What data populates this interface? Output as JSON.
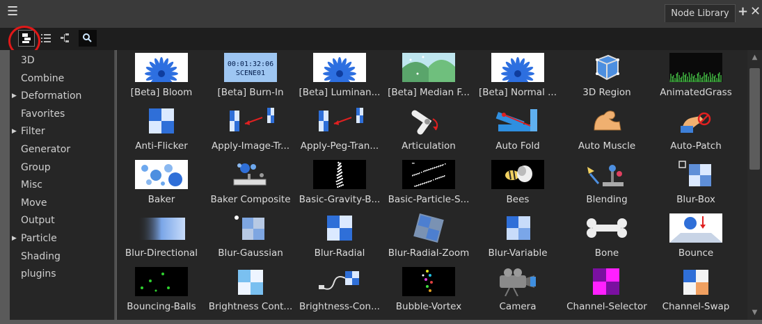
{
  "window": {
    "title": "Node Library",
    "menu_icon": "hamburger-menu-icon",
    "add_icon": "plus-icon",
    "close_icon": "close-icon"
  },
  "toolbar": {
    "buttons": [
      {
        "icon": "thumbnail-view-icon",
        "selected": true
      },
      {
        "icon": "list-view-icon"
      },
      {
        "icon": "tree-view-icon"
      },
      {
        "icon": "search-icon"
      }
    ]
  },
  "categories": [
    {
      "label": "3D",
      "expandable": false
    },
    {
      "label": "Combine",
      "expandable": false
    },
    {
      "label": "Deformation",
      "expandable": true
    },
    {
      "label": "Favorites",
      "expandable": false
    },
    {
      "label": "Filter",
      "expandable": true
    },
    {
      "label": "Generator",
      "expandable": false
    },
    {
      "label": "Group",
      "expandable": false
    },
    {
      "label": "Misc",
      "expandable": false
    },
    {
      "label": "Move",
      "expandable": false
    },
    {
      "label": "Output",
      "expandable": false
    },
    {
      "label": "Particle",
      "expandable": true
    },
    {
      "label": "Shading",
      "expandable": false
    },
    {
      "label": "plugins",
      "expandable": false
    }
  ],
  "nodes": [
    {
      "label": "[Beta] Bloom",
      "icon": "flower-icon"
    },
    {
      "label": "[Beta] Burn-In",
      "icon": "timecode-icon",
      "timecode": "00:01:32:06",
      "scene": "SCENE01"
    },
    {
      "label": "[Beta] Luminan...",
      "icon": "flower-icon"
    },
    {
      "label": "[Beta] Median F...",
      "icon": "landscape-icon"
    },
    {
      "label": "[Beta] Normal ...",
      "icon": "flower-icon"
    },
    {
      "label": "3D Region",
      "icon": "3d-region-icon"
    },
    {
      "label": "AnimatedGrass",
      "icon": "grass-icon"
    },
    {
      "label": "Anti-Flicker",
      "icon": "checker-icon"
    },
    {
      "label": "Apply-Image-Tr...",
      "icon": "apply-transform-icon"
    },
    {
      "label": "Apply-Peg-Tran...",
      "icon": "apply-transform-icon"
    },
    {
      "label": "Articulation",
      "icon": "articulation-icon"
    },
    {
      "label": "Auto Fold",
      "icon": "auto-fold-icon"
    },
    {
      "label": "Auto Muscle",
      "icon": "muscle-arm-icon"
    },
    {
      "label": "Auto-Patch",
      "icon": "auto-patch-icon"
    },
    {
      "label": "Baker",
      "icon": "bubbles-icon"
    },
    {
      "label": "Baker Composite",
      "icon": "baker-composite-icon"
    },
    {
      "label": "Basic-Gravity-B...",
      "icon": "particles-column-icon"
    },
    {
      "label": "Basic-Particle-S...",
      "icon": "particles-scatter-icon"
    },
    {
      "label": "Bees",
      "icon": "bees-icon"
    },
    {
      "label": "Blending",
      "icon": "blending-icon"
    },
    {
      "label": "Blur-Box",
      "icon": "blur-box-icon"
    },
    {
      "label": "Blur-Directional",
      "icon": "blur-directional-icon"
    },
    {
      "label": "Blur-Gaussian",
      "icon": "blur-gaussian-icon"
    },
    {
      "label": "Blur-Radial",
      "icon": "blur-radial-icon"
    },
    {
      "label": "Blur-Radial-Zoom",
      "icon": "blur-radial-zoom-icon"
    },
    {
      "label": "Blur-Variable",
      "icon": "blur-variable-icon"
    },
    {
      "label": "Bone",
      "icon": "bone-icon"
    },
    {
      "label": "Bounce",
      "icon": "bounce-icon"
    },
    {
      "label": "Bouncing-Balls",
      "icon": "bouncing-balls-icon"
    },
    {
      "label": "Brightness Cont...",
      "icon": "brightness-contrast-icon"
    },
    {
      "label": "Brightness-Con...",
      "icon": "brightness-contrast-plug-icon"
    },
    {
      "label": "Bubble-Vortex",
      "icon": "bubble-vortex-icon"
    },
    {
      "label": "Camera",
      "icon": "camera-icon"
    },
    {
      "label": "Channel-Selector",
      "icon": "channel-selector-icon"
    },
    {
      "label": "Channel-Swap",
      "icon": "channel-swap-icon"
    }
  ],
  "colors": {
    "panel_bg": "#262626",
    "window_bg": "#5a5a5a",
    "highlight_circle": "#e01818",
    "text": "#dcdcdc"
  }
}
